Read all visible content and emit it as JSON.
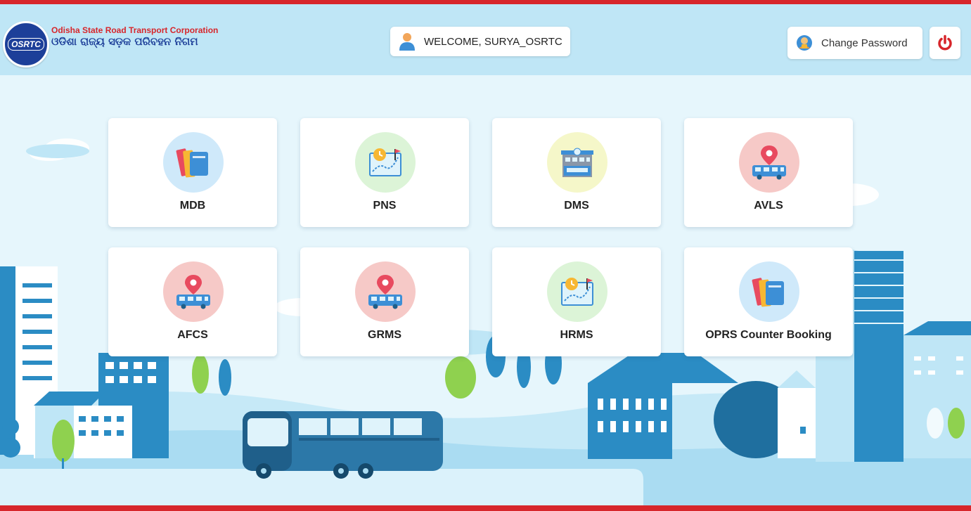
{
  "header": {
    "logo_text": "OSRTC",
    "org_name_en": "Odisha State Road Transport Corporation",
    "org_name_od": "ଓଡିଶା ରାଜ୍ୟ ସଡ଼କ ପରିବହନ ନିଗମ",
    "welcome_text": "WELCOME, SURYA_OSRTC",
    "change_password_label": "Change Password",
    "logout_icon": "power-icon"
  },
  "modules": [
    {
      "label": "MDB",
      "icon": "folders-icon"
    },
    {
      "label": "PNS",
      "icon": "route-map-icon"
    },
    {
      "label": "DMS",
      "icon": "depot-building-icon"
    },
    {
      "label": "AVLS",
      "icon": "bus-location-icon"
    },
    {
      "label": "AFCS",
      "icon": "bus-location-icon"
    },
    {
      "label": "GRMS",
      "icon": "bus-location-icon"
    },
    {
      "label": "HRMS",
      "icon": "route-map-icon"
    },
    {
      "label": "OPRS Counter Booking",
      "icon": "folders-icon"
    }
  ],
  "colors": {
    "accent_red": "#d7262b",
    "brand_blue": "#1d3f99",
    "header_bg": "#bfe6f6",
    "page_bg": "#e7f6fc",
    "city_blue": "#2b8cc4",
    "bus_blue": "#2c78a8"
  }
}
